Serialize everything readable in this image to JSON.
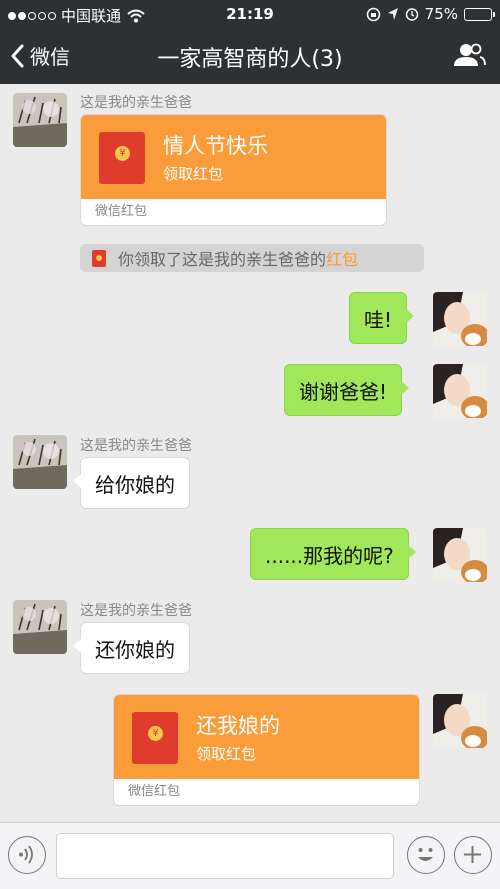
{
  "status_bar": {
    "carrier": "中国联通",
    "time": "21:19",
    "battery": "75%",
    "battery_level": 0.75
  },
  "nav": {
    "back_label": "微信",
    "title": "一家高智商的人(3)"
  },
  "messages": {
    "m1": {
      "sender": "这是我的亲生爸爸",
      "red_packet": {
        "title": "情人节快乐",
        "action": "领取红包",
        "footer": "微信红包"
      }
    },
    "system": {
      "prefix": "你领取了这是我的亲生爸爸的",
      "link": "红包"
    },
    "m2": {
      "text": "哇!"
    },
    "m3": {
      "text": "谢谢爸爸!"
    },
    "m4": {
      "sender": "这是我的亲生爸爸",
      "text": "给你娘的"
    },
    "m5": {
      "text": "......那我的呢?"
    },
    "m6": {
      "sender": "这是我的亲生爸爸",
      "text": "还你娘的"
    },
    "m7": {
      "red_packet": {
        "title": "还我娘的",
        "action": "领取红包",
        "footer": "微信红包"
      }
    }
  },
  "input": {
    "value": ""
  },
  "icons": {
    "voice": "voice-icon",
    "emoji": "emoji-icon",
    "plus": "plus-icon",
    "contacts": "contacts-icon"
  }
}
